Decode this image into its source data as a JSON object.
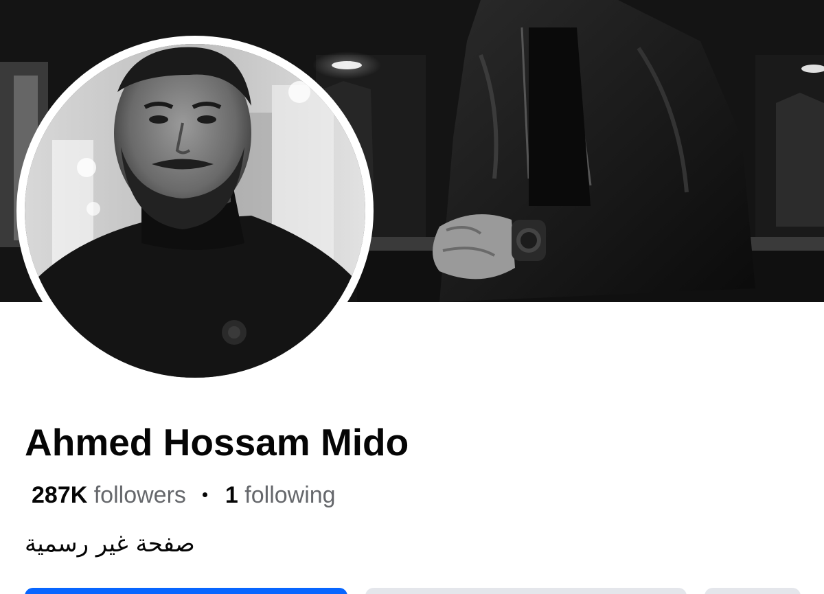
{
  "profile": {
    "name": "Ahmed Hossam Mido",
    "followers_count": "287K",
    "followers_label": "followers",
    "following_count": "1",
    "following_label": "following",
    "bio": "صفحة غير رسمية"
  },
  "colors": {
    "primary_button": "#0866ff",
    "secondary_button": "#e4e6eb",
    "name_text": "#050505",
    "secondary_text": "#65676b"
  }
}
